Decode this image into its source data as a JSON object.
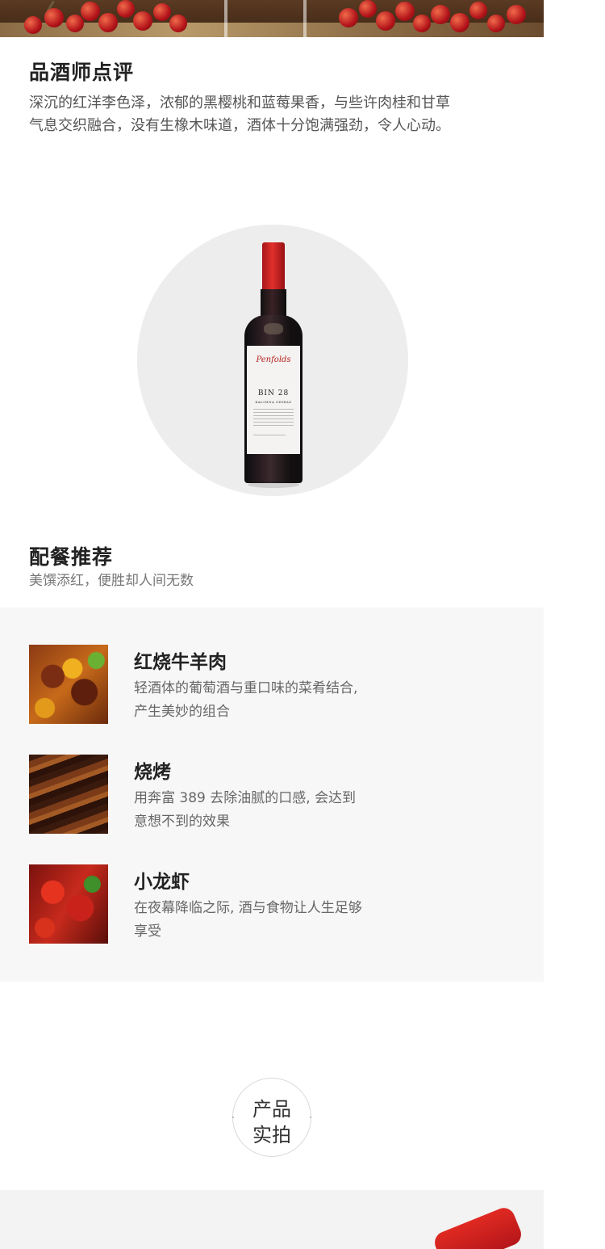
{
  "tasting": {
    "title": "品酒师点评",
    "line1": "深沉的红洋李色泽，浓郁的黑樱桃和蓝莓果香，与些许肉桂和甘草",
    "line2": "气息交织融合，没有生橡木味道，酒体十分饱满强劲，令人心动。"
  },
  "bottle": {
    "brand": "Penfolds",
    "bin": "BIN 28",
    "variety": "KALIMNA SHIRAZ"
  },
  "pairing": {
    "title": "配餐推荐",
    "subtitle": "美馔添红，便胜却人间无数",
    "items": [
      {
        "name": "红烧牛羊肉",
        "desc1": "轻酒体的葡萄酒与重口味的菜肴结合,",
        "desc2": "产生美妙的组合",
        "image": "braised-meat-photo"
      },
      {
        "name": "烧烤",
        "desc1": "用奔富 389 去除油腻的口感, 会达到",
        "desc2": "意想不到的效果",
        "image": "barbecue-photo"
      },
      {
        "name": "小龙虾",
        "desc1": "在夜幕降临之际, 酒与食物让人生足够",
        "desc2": "享受",
        "image": "crayfish-photo"
      }
    ]
  },
  "badge": {
    "line1": "产品",
    "line2": "实拍"
  },
  "colors": {
    "panel": "#f7f7f7",
    "capsule": "#d42a26",
    "text_dark": "#222222",
    "text_body": "#555555"
  }
}
